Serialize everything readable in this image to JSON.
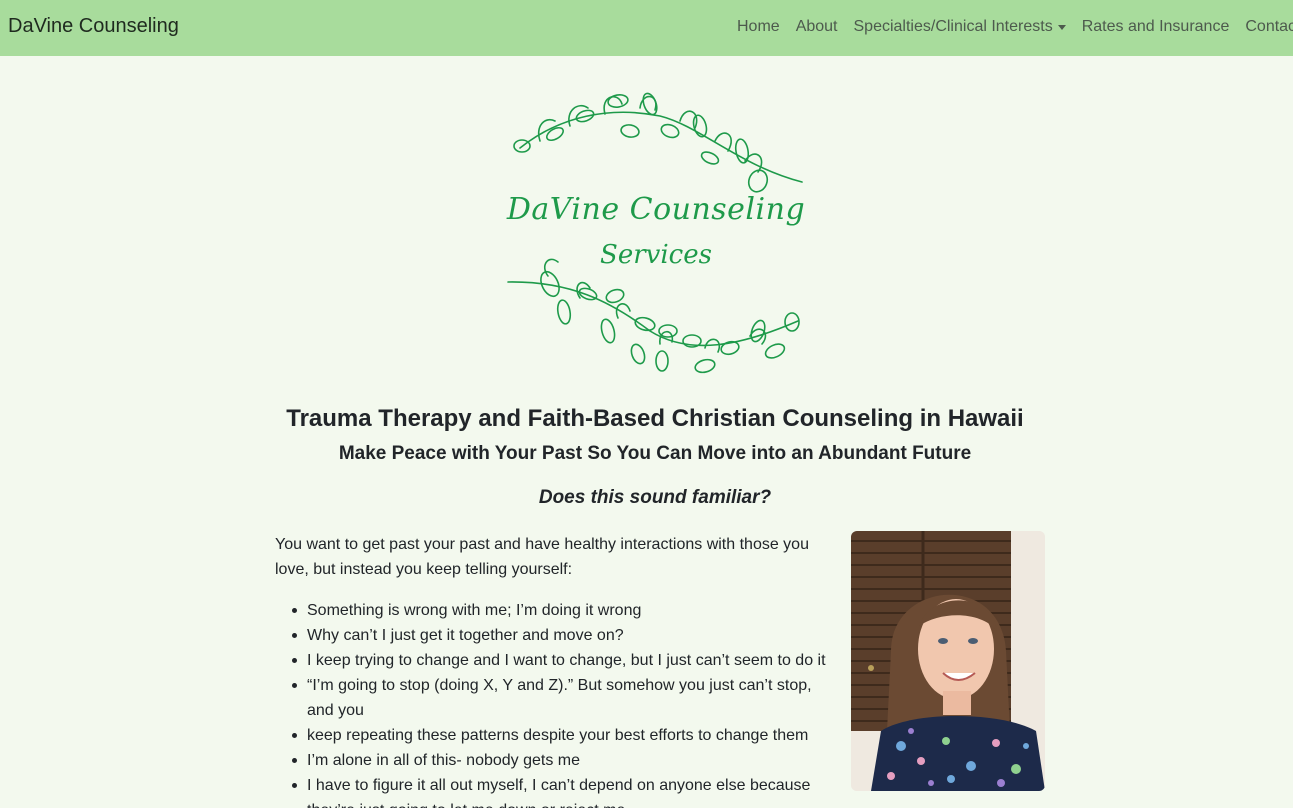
{
  "navbar": {
    "brand": "DaVine Counseling",
    "links": [
      "Home",
      "About",
      "Specialties/Clinical Interests",
      "Rates and Insurance",
      "Contact"
    ]
  },
  "logo": {
    "title": "DaVine Counseling",
    "subtitle": "Services"
  },
  "hero": {
    "heading": "Trauma Therapy and Faith-Based Christian Counseling in Hawaii",
    "subheading": "Make Peace with Your Past So You Can Move into an Abundant Future",
    "question": "Does this sound familiar?"
  },
  "body": {
    "intro": "You want to get past your past and have healthy interactions with those you love, but instead you keep telling yourself:",
    "bullets": [
      "Something is wrong with me; I’m doing it wrong",
      "Why can’t I just get it together and move on?",
      "I keep trying to change and I want to change, but I just can’t seem to do it",
      "“I’m going to stop (doing X, Y and Z).” But somehow you just can’t stop, and you",
      "keep repeating these patterns despite your best efforts to change them",
      "I’m alone in all of this- nobody gets me",
      "I have to figure it all out myself, I can’t depend on anyone else because they’re just going to let me down or reject me"
    ]
  },
  "colors": {
    "navbar_bg": "#a8dc9c",
    "page_bg": "#f3f9ee",
    "logo_green": "#1e9a4a"
  }
}
